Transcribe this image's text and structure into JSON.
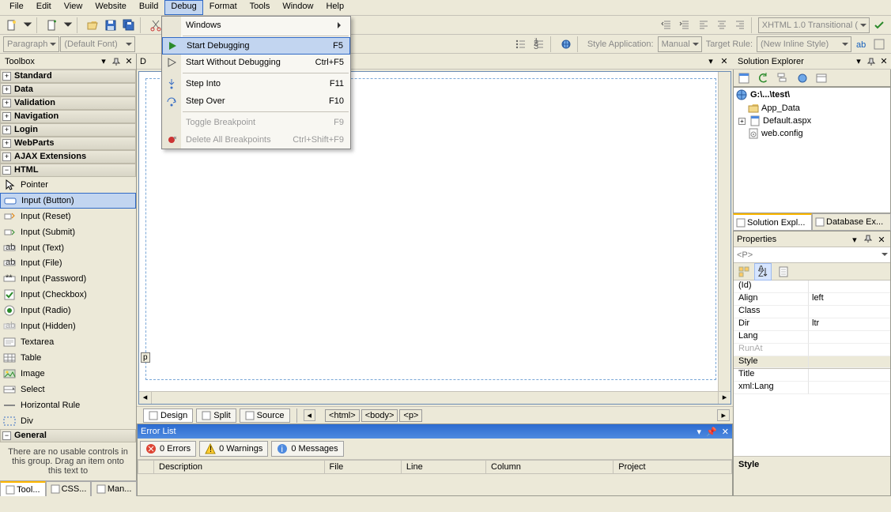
{
  "menubar": [
    "File",
    "Edit",
    "View",
    "Website",
    "Build",
    "Debug",
    "Format",
    "Tools",
    "Window",
    "Help"
  ],
  "menubar_open_index": 5,
  "debug_menu": [
    {
      "label": "Windows",
      "shortcut": "",
      "icon": "",
      "submenu": true
    },
    {
      "sep": true
    },
    {
      "label": "Start Debugging",
      "shortcut": "F5",
      "icon": "play",
      "highlight": true
    },
    {
      "label": "Start Without Debugging",
      "shortcut": "Ctrl+F5",
      "icon": "play-outline"
    },
    {
      "sep": true
    },
    {
      "label": "Step Into",
      "shortcut": "F11",
      "icon": "step-into"
    },
    {
      "label": "Step Over",
      "shortcut": "F10",
      "icon": "step-over"
    },
    {
      "sep": true
    },
    {
      "label": "Toggle Breakpoint",
      "shortcut": "F9",
      "disabled": true
    },
    {
      "label": "Delete All Breakpoints",
      "shortcut": "Ctrl+Shift+F9",
      "icon": "breakpoint-delete",
      "disabled": true
    }
  ],
  "toolbar2": {
    "paragraph": "Paragraph",
    "font": "(Default Font)",
    "style_app_label": "Style Application:",
    "style_app_value": "Manual",
    "target_rule_label": "Target Rule:",
    "target_rule_value": "(New Inline Style)"
  },
  "toolbar1": {
    "doctype": "XHTML 1.0 Transitional ("
  },
  "toolbox": {
    "title": "Toolbox",
    "categories": [
      {
        "name": "Standard",
        "expanded": false
      },
      {
        "name": "Data",
        "expanded": false
      },
      {
        "name": "Validation",
        "expanded": false
      },
      {
        "name": "Navigation",
        "expanded": false
      },
      {
        "name": "Login",
        "expanded": false
      },
      {
        "name": "WebParts",
        "expanded": false
      },
      {
        "name": "AJAX Extensions",
        "expanded": false
      },
      {
        "name": "HTML",
        "expanded": true
      }
    ],
    "html_items": [
      {
        "label": "Pointer",
        "icon": "pointer"
      },
      {
        "label": "Input (Button)",
        "icon": "button",
        "selected": true
      },
      {
        "label": "Input (Reset)",
        "icon": "reset"
      },
      {
        "label": "Input (Submit)",
        "icon": "submit"
      },
      {
        "label": "Input (Text)",
        "icon": "text"
      },
      {
        "label": "Input (File)",
        "icon": "file"
      },
      {
        "label": "Input (Password)",
        "icon": "password"
      },
      {
        "label": "Input (Checkbox)",
        "icon": "checkbox"
      },
      {
        "label": "Input (Radio)",
        "icon": "radio"
      },
      {
        "label": "Input (Hidden)",
        "icon": "hidden"
      },
      {
        "label": "Textarea",
        "icon": "textarea"
      },
      {
        "label": "Table",
        "icon": "table"
      },
      {
        "label": "Image",
        "icon": "image"
      },
      {
        "label": "Select",
        "icon": "select"
      },
      {
        "label": "Horizontal Rule",
        "icon": "hr"
      },
      {
        "label": "Div",
        "icon": "div"
      }
    ],
    "general": {
      "name": "General",
      "text": "There are no usable controls in this group. Drag an item onto this text to"
    }
  },
  "bottom_tabs": [
    {
      "label": "Tool...",
      "active": true
    },
    {
      "label": "CSS..."
    },
    {
      "label": "Man..."
    }
  ],
  "designer": {
    "tag": "p",
    "modes": [
      {
        "label": "Design",
        "active": true
      },
      {
        "label": "Split"
      },
      {
        "label": "Source"
      }
    ],
    "breadcrumb": [
      "<html>",
      "<body>",
      "<p>"
    ]
  },
  "errorlist": {
    "title": "Error List",
    "tabs": [
      {
        "label": "0 Errors",
        "icon": "error"
      },
      {
        "label": "0 Warnings",
        "icon": "warning"
      },
      {
        "label": "0 Messages",
        "icon": "info"
      }
    ],
    "columns": [
      "",
      "Description",
      "File",
      "Line",
      "Column",
      "Project"
    ]
  },
  "solution": {
    "title": "Solution Explorer",
    "root": "G:\\...\\test\\",
    "nodes": [
      {
        "label": "App_Data",
        "icon": "folder"
      },
      {
        "label": "Default.aspx",
        "icon": "aspx",
        "expandable": true
      },
      {
        "label": "web.config",
        "icon": "config"
      }
    ],
    "tabs": [
      {
        "label": "Solution Expl...",
        "active": true
      },
      {
        "label": "Database Ex..."
      }
    ]
  },
  "properties": {
    "title": "Properties",
    "selector": "<P>",
    "rows": [
      {
        "k": "(Id)",
        "v": ""
      },
      {
        "k": "Align",
        "v": "left"
      },
      {
        "k": "Class",
        "v": ""
      },
      {
        "k": "Dir",
        "v": "ltr"
      },
      {
        "k": "Lang",
        "v": ""
      },
      {
        "k": "RunAt",
        "v": "",
        "dim": true
      },
      {
        "k": "Style",
        "v": "",
        "sel": true
      },
      {
        "k": "Title",
        "v": ""
      },
      {
        "k": "xml:Lang",
        "v": ""
      }
    ],
    "desc": "Style"
  }
}
